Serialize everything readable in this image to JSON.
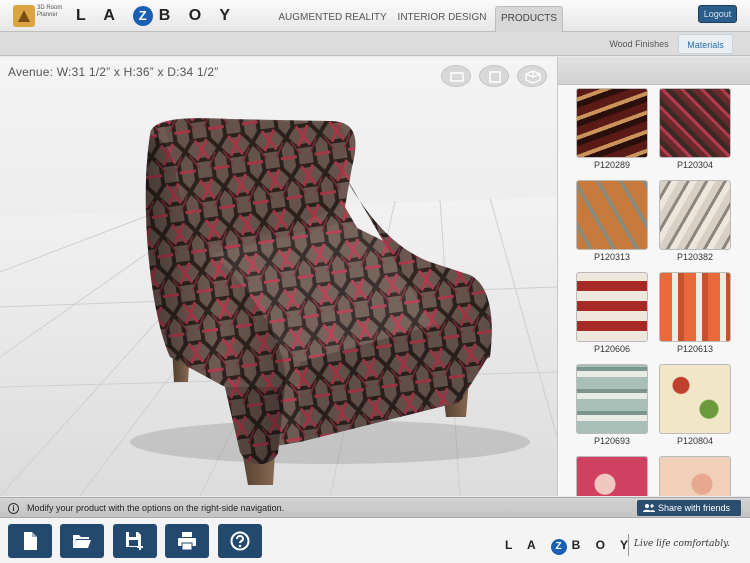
{
  "app": {
    "planner_logo_text": "3D Room Planner",
    "brand": {
      "pre": "L A",
      "z": "Z",
      "post": "B O Y"
    }
  },
  "nav": {
    "tabs": [
      {
        "label": "AUGMENTED REALITY",
        "active": false
      },
      {
        "label": "INTERIOR DESIGN",
        "active": false
      },
      {
        "label": "PRODUCTS",
        "active": true
      }
    ],
    "logout_label": "Logout"
  },
  "subnav": {
    "tabs": [
      {
        "label": "Wood Finishes",
        "active": false
      },
      {
        "label": "Materials",
        "active": true
      }
    ]
  },
  "viewport": {
    "dimensions_text": "Avenue: W:31 1/2” x H:36” x D:34 1/2”",
    "view_buttons": [
      "front-view-icon",
      "top-view-icon",
      "perspective-view-icon"
    ]
  },
  "materials": [
    {
      "code": "P120289",
      "colors": [
        "#5a1a16",
        "#c9935a",
        "#2a0f0d"
      ]
    },
    {
      "code": "P120304",
      "colors": [
        "#6a2a2c",
        "#b23b4d",
        "#3a2a24"
      ]
    },
    {
      "code": "P120313",
      "colors": [
        "#c87a3c",
        "#8a8a7a",
        "#5e5e52"
      ]
    },
    {
      "code": "P120382",
      "colors": [
        "#d8d0c4",
        "#8c8680",
        "#ece6dc"
      ]
    },
    {
      "code": "P120606",
      "colors": [
        "#efe6dc",
        "#a82a26",
        "#7a1e1a"
      ]
    },
    {
      "code": "P120613",
      "colors": [
        "#f2e9e0",
        "#e86a3a",
        "#c8502a"
      ]
    },
    {
      "code": "P120693",
      "colors": [
        "#a8c0b8",
        "#e8ece4",
        "#7a968e"
      ]
    },
    {
      "code": "P120804",
      "colors": [
        "#f1e6c8",
        "#c0402e",
        "#6a9a3a"
      ]
    },
    {
      "code": "",
      "colors": [
        "#d04060",
        "#f0c8c0",
        "#8a2a3a"
      ]
    },
    {
      "code": "",
      "colors": [
        "#e8a890",
        "#c05060",
        "#f0d0b8"
      ]
    }
  ],
  "status": {
    "message": "Modify your product with the options on the right-side navigation.",
    "share_label": "Share with friends"
  },
  "toolbar": {
    "buttons": [
      "new-file-icon",
      "open-folder-icon",
      "save-add-icon",
      "print-icon",
      "help-icon"
    ]
  },
  "footer": {
    "brand": {
      "pre": "L A",
      "z": "Z",
      "post": "B O Y"
    },
    "tagline": "Live life comfortably."
  },
  "colors": {
    "accent": "#234a6e",
    "brand_blue": "#1a5fb4",
    "active_tab": "#2a6fb0",
    "fabric_base": "#6e5a52",
    "fabric_dark": "#2e2420",
    "fabric_red": "#b23b4d"
  }
}
